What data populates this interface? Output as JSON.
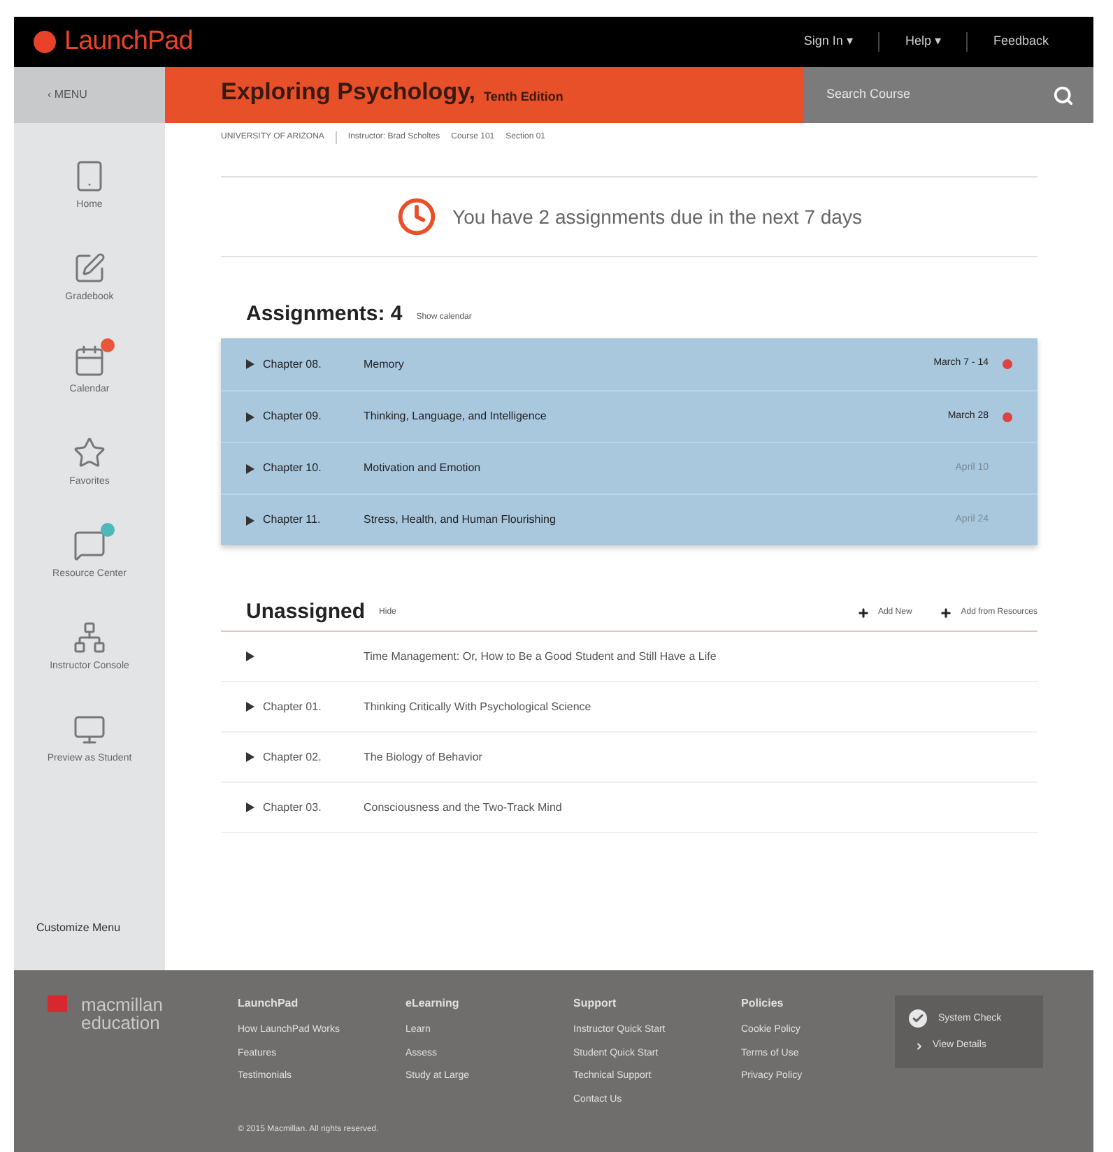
{
  "header": {
    "logo": "LaunchPad",
    "nav": [
      "Sign In ▾",
      "Help ▾",
      "Feedback"
    ]
  },
  "menu_button": "‹ MENU",
  "course": {
    "title": "Exploring Psychology,",
    "edition": "Tenth Edition"
  },
  "search": {
    "placeholder": "Search Course"
  },
  "breadcrumb": [
    "UNIVERSITY OF ARIZONA",
    "Instructor: Brad Scholtes",
    "Course 101",
    "Section 01"
  ],
  "sidebar": {
    "items": [
      {
        "kind": "home",
        "label": "Home"
      },
      {
        "kind": "gradebook",
        "label": "Gradebook"
      },
      {
        "kind": "calendar",
        "label": "Calendar",
        "color": "#e8553a"
      },
      {
        "kind": "favorites",
        "label": "Favorites"
      },
      {
        "kind": "resources",
        "label": "Resource Center",
        "color": "#4fb8b8"
      },
      {
        "kind": "console",
        "label": "Instructor Console"
      },
      {
        "kind": "preview",
        "label": "Preview as Student"
      }
    ],
    "footer_link": "Customize Menu"
  },
  "alert": "You have 2 assignments due in the next 7 days",
  "assignments": {
    "title": "Assignments: 4",
    "link": "Show calendar",
    "rows": [
      {
        "chapter": "Chapter 08.",
        "title": "Memory",
        "due": "March 7 - 14",
        "due_soon": true
      },
      {
        "chapter": "Chapter 09.",
        "title": "Thinking, Language, and Intelligence",
        "due": "March 28",
        "due_soon": true
      },
      {
        "chapter": "Chapter 10.",
        "title": "Motivation and Emotion",
        "due": "April 10",
        "due_soon": false
      },
      {
        "chapter": "Chapter 11.",
        "title": "Stress, Health, and Human Flourishing",
        "due": "April 24",
        "due_soon": false
      }
    ]
  },
  "unassigned": {
    "title": "Unassigned",
    "link": "Hide",
    "actions": [
      "Add New",
      "Add from Resources"
    ],
    "rows": [
      {
        "chapter": "",
        "title": "Time Management: Or, How to Be a Good Student and Still Have a Life"
      },
      {
        "chapter": "Chapter 01.",
        "title": "Thinking Critically With Psychological Science"
      },
      {
        "chapter": "Chapter 02.",
        "title": "The Biology of Behavior"
      },
      {
        "chapter": "Chapter 03.",
        "title": "Consciousness and the Two-Track Mind"
      }
    ]
  },
  "footer": {
    "brand": [
      "macmillan",
      "education"
    ],
    "columns": [
      {
        "heading": "LaunchPad",
        "links": [
          "How LaunchPad Works",
          "Features",
          "Testimonials"
        ]
      },
      {
        "heading": "eLearning",
        "links": [
          "Learn",
          "Assess",
          "Study at Large"
        ]
      },
      {
        "heading": "Support",
        "links": [
          "Instructor Quick Start",
          "Student Quick Start",
          "Technical Support",
          "Contact Us"
        ]
      },
      {
        "heading": "Policies",
        "links": [
          "Cookie Policy",
          "Terms of Use",
          "Privacy Policy"
        ]
      }
    ],
    "status": {
      "title": "System Check",
      "link": "View Details"
    },
    "copyright": "© 2015 Macmillan. All rights reserved."
  }
}
